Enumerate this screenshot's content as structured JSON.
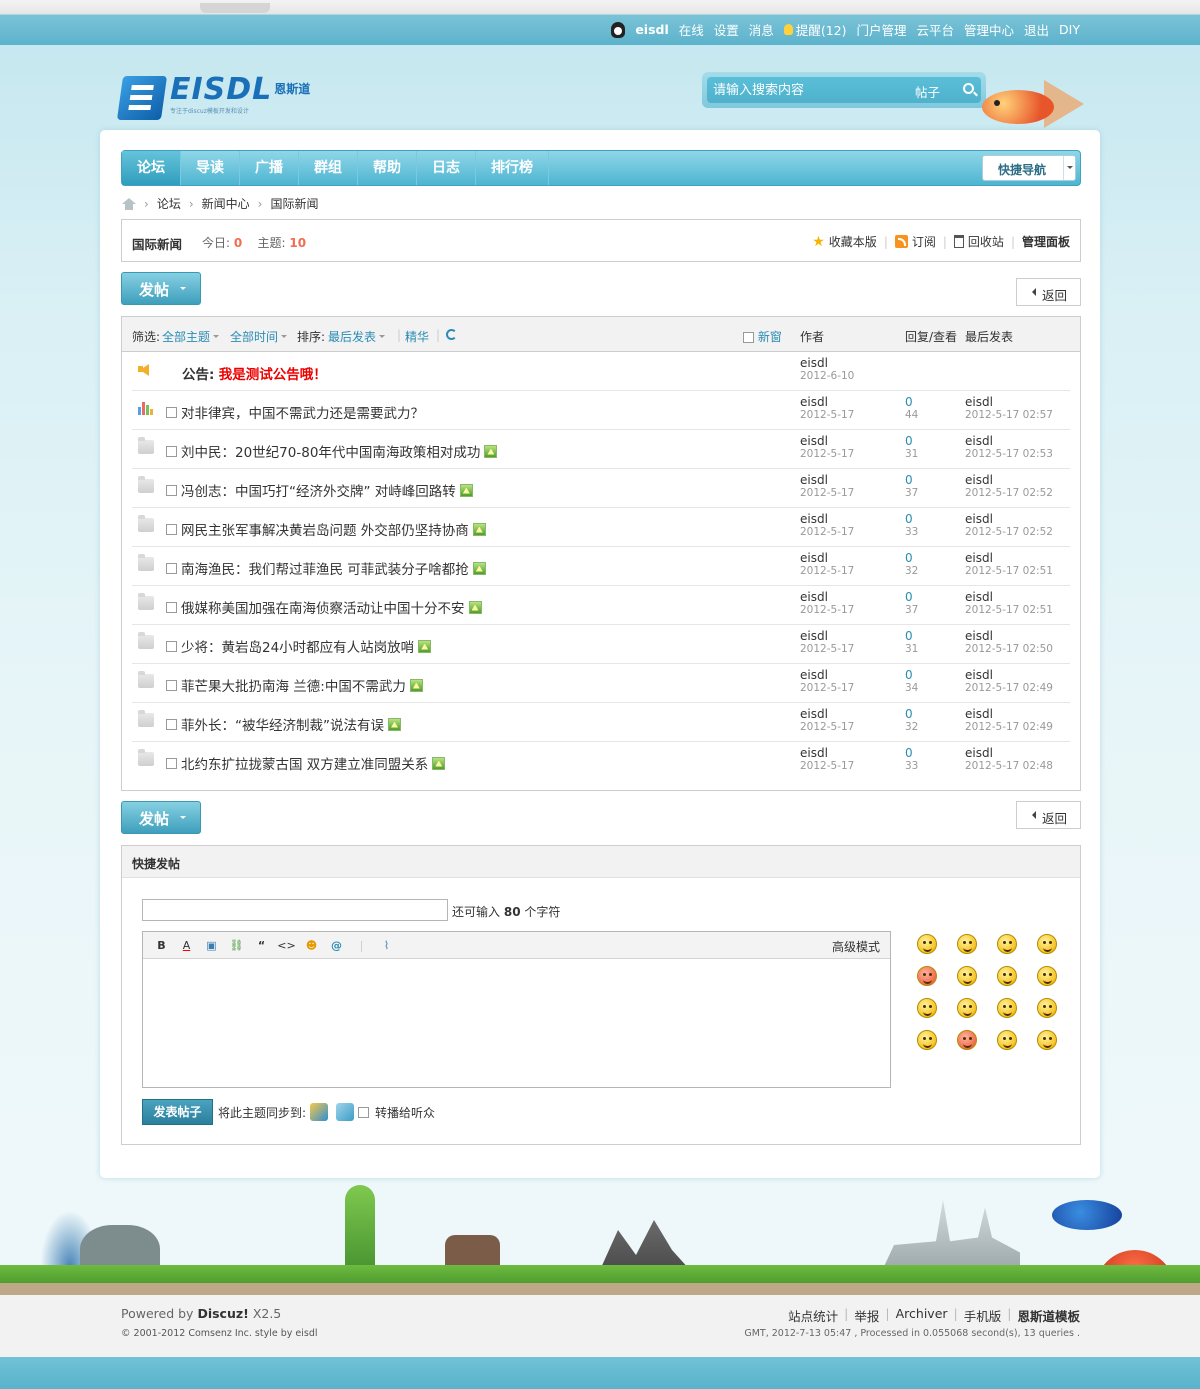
{
  "topbar": {
    "username": "eisdl",
    "links": [
      "在线",
      "设置",
      "消息"
    ],
    "remind": "提醒(12)",
    "links2": [
      "门户管理",
      "云平台",
      "管理中心",
      "退出",
      "DIY"
    ]
  },
  "logo": {
    "text": "EISDL",
    "cn": "恩斯道",
    "sub": "专注于discuz模板开发和设计"
  },
  "search": {
    "placeholder": "请输入搜索内容",
    "type": "帖子"
  },
  "nav": {
    "items": [
      "论坛",
      "导读",
      "广播",
      "群组",
      "帮助",
      "日志",
      "排行榜"
    ],
    "quicknav": "快捷导航"
  },
  "breadcrumb": [
    "论坛",
    "新闻中心",
    "国际新闻"
  ],
  "forum": {
    "name": "国际新闻",
    "today_label": "今日:",
    "today": "0",
    "topics_label": "主题:",
    "topics": "10",
    "actions": [
      "收藏本版",
      "订阅",
      "回收站",
      "管理面板"
    ]
  },
  "buttons": {
    "post": "发帖",
    "back": "返回",
    "submit": "发表帖子"
  },
  "filter": {
    "label": "筛选:",
    "theme": "全部主题",
    "time": "全部时间",
    "sort_label": "排序:",
    "sort": "最后发表",
    "digest": "精华",
    "newwin": "新窗",
    "col_author": "作者",
    "col_reply": "回复/查看",
    "col_last": "最后发表"
  },
  "announcement": {
    "label": "公告:",
    "text": "我是测试公告哦！",
    "author": "eisdl",
    "date": "2012-6-10"
  },
  "threads": [
    {
      "title": "对非律宾，中国不需武力还是需要武力？",
      "author": "eisdl",
      "date": "2012-5-17",
      "replies": "0",
      "views": "44",
      "last_user": "eisdl",
      "last_time": "2012-5-17 02:57",
      "icon": "poll",
      "img": false
    },
    {
      "title": "刘中民：20世纪70-80年代中国南海政策相对成功",
      "author": "eisdl",
      "date": "2012-5-17",
      "replies": "0",
      "views": "31",
      "last_user": "eisdl",
      "last_time": "2012-5-17 02:53",
      "icon": "folder",
      "img": true
    },
    {
      "title": "冯创志：中国巧打“经济外交牌” 对峙峰回路转",
      "author": "eisdl",
      "date": "2012-5-17",
      "replies": "0",
      "views": "37",
      "last_user": "eisdl",
      "last_time": "2012-5-17 02:52",
      "icon": "folder",
      "img": true
    },
    {
      "title": "网民主张军事解决黄岩岛问题 外交部仍坚持协商",
      "author": "eisdl",
      "date": "2012-5-17",
      "replies": "0",
      "views": "33",
      "last_user": "eisdl",
      "last_time": "2012-5-17 02:52",
      "icon": "folder",
      "img": true
    },
    {
      "title": "南海渔民：我们帮过菲渔民 可菲武装分子啥都抢",
      "author": "eisdl",
      "date": "2012-5-17",
      "replies": "0",
      "views": "32",
      "last_user": "eisdl",
      "last_time": "2012-5-17 02:51",
      "icon": "folder",
      "img": true
    },
    {
      "title": "俄媒称美国加强在南海侦察活动让中国十分不安",
      "author": "eisdl",
      "date": "2012-5-17",
      "replies": "0",
      "views": "37",
      "last_user": "eisdl",
      "last_time": "2012-5-17 02:51",
      "icon": "folder",
      "img": true
    },
    {
      "title": "少将：黄岩岛24小时都应有人站岗放哨",
      "author": "eisdl",
      "date": "2012-5-17",
      "replies": "0",
      "views": "31",
      "last_user": "eisdl",
      "last_time": "2012-5-17 02:50",
      "icon": "folder",
      "img": true
    },
    {
      "title": "菲芒果大批扔南海 兰德:中国不需武力",
      "author": "eisdl",
      "date": "2012-5-17",
      "replies": "0",
      "views": "34",
      "last_user": "eisdl",
      "last_time": "2012-5-17 02:49",
      "icon": "folder",
      "img": true
    },
    {
      "title": "菲外长：“被华经济制裁”说法有误",
      "author": "eisdl",
      "date": "2012-5-17",
      "replies": "0",
      "views": "32",
      "last_user": "eisdl",
      "last_time": "2012-5-17 02:49",
      "icon": "folder",
      "img": true
    },
    {
      "title": "北约东扩拉拢蒙古国 双方建立准同盟关系",
      "author": "eisdl",
      "date": "2012-5-17",
      "replies": "0",
      "views": "33",
      "last_user": "eisdl",
      "last_time": "2012-5-17 02:48",
      "icon": "folder",
      "img": true
    }
  ],
  "quickpost": {
    "title": "快捷发帖",
    "count_pre": "还可输入",
    "count": "80",
    "count_post": "个字符",
    "toolbar": [
      "B",
      "A",
      "▣",
      "⛓",
      "“",
      "<>",
      "☻",
      "@",
      "|",
      "⌇"
    ],
    "advanced": "高级模式",
    "sync_label": "将此主题同步到:",
    "broadcast": "转播给听众"
  },
  "footer": {
    "powered_pre": "Powered by",
    "powered_brand": "Discuz!",
    "powered_ver": "X2.5",
    "copyright": "© 2001-2012 Comsenz Inc. style by eisdl",
    "links": [
      "站点统计",
      "举报",
      "Archiver",
      "手机版",
      "恩斯道模板"
    ],
    "gmt": "GMT, 2012-7-13 05:47 , Processed in 0.055068 second(s), 13 queries ."
  },
  "colors": {
    "accent": "#2b8cb4",
    "nav": "#4db5d1",
    "highlight": "#f26c4f",
    "announce": "#ee0000"
  }
}
